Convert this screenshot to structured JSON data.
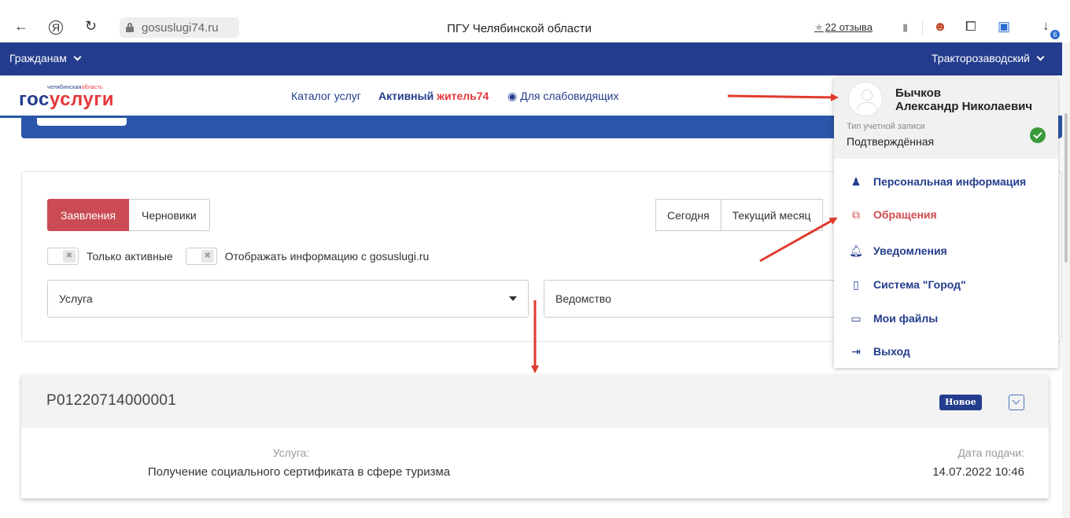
{
  "browser": {
    "back": "←",
    "yandex": "Я",
    "reload": "↻",
    "url": "gosuslugi74.ru",
    "title": "ПГУ Челябинской области",
    "reviews": "22 отзыва",
    "download": "↓",
    "download_count": "6"
  },
  "topnav": {
    "citizens": "Гражданам",
    "district": "Тракторозаводский"
  },
  "header": {
    "logo_region_a": "челябинская",
    "logo_region_b": "область",
    "logo_a": "гос",
    "logo_b": "услуги",
    "catalog": "Каталог услуг",
    "active_a": "Активный ",
    "active_b": "житель74",
    "low_vision": "Для слабовидящих"
  },
  "filters": {
    "tab_apps": "Заявления",
    "tab_drafts": "Черновики",
    "today": "Сегодня",
    "current_month": "Текущий месяц",
    "only_active": "Только активные",
    "show_gosuslugi": "Отображать информацию с gosuslugi.ru",
    "service_select": "Услуга",
    "department_select": "Ведомство"
  },
  "application": {
    "id": "P01220714000001",
    "badge": "Новое",
    "service_label": "Услуга:",
    "service_value": "Получение социального сертификата в сфере туризма",
    "date_label": "Дата подачи:",
    "date_value": "14.07.2022 10:46"
  },
  "user_menu": {
    "surname": "Бычков",
    "given_names": "Александр Николаевич",
    "account_type_label": "Тип учетной записи",
    "account_type_value": "Подтверждённая",
    "items": [
      {
        "label": "Персональная информация",
        "icon": "user-icon",
        "glyph": "♟"
      },
      {
        "label": "Обращения",
        "icon": "copy-icon",
        "glyph": "⧉"
      },
      {
        "label": "Уведомления",
        "icon": "bell-icon",
        "glyph": "🔔︎"
      },
      {
        "label": "Система \"Город\"",
        "icon": "building-icon",
        "glyph": "▯"
      },
      {
        "label": "Мои файлы",
        "icon": "folder-icon",
        "glyph": "▭"
      },
      {
        "label": "Выход",
        "icon": "exit-icon",
        "glyph": "⇥"
      }
    ]
  },
  "colors": {
    "nav_blue": "#233c8d",
    "accent_red": "#ca4b54",
    "annotation_arrow": "#e03a2e"
  }
}
